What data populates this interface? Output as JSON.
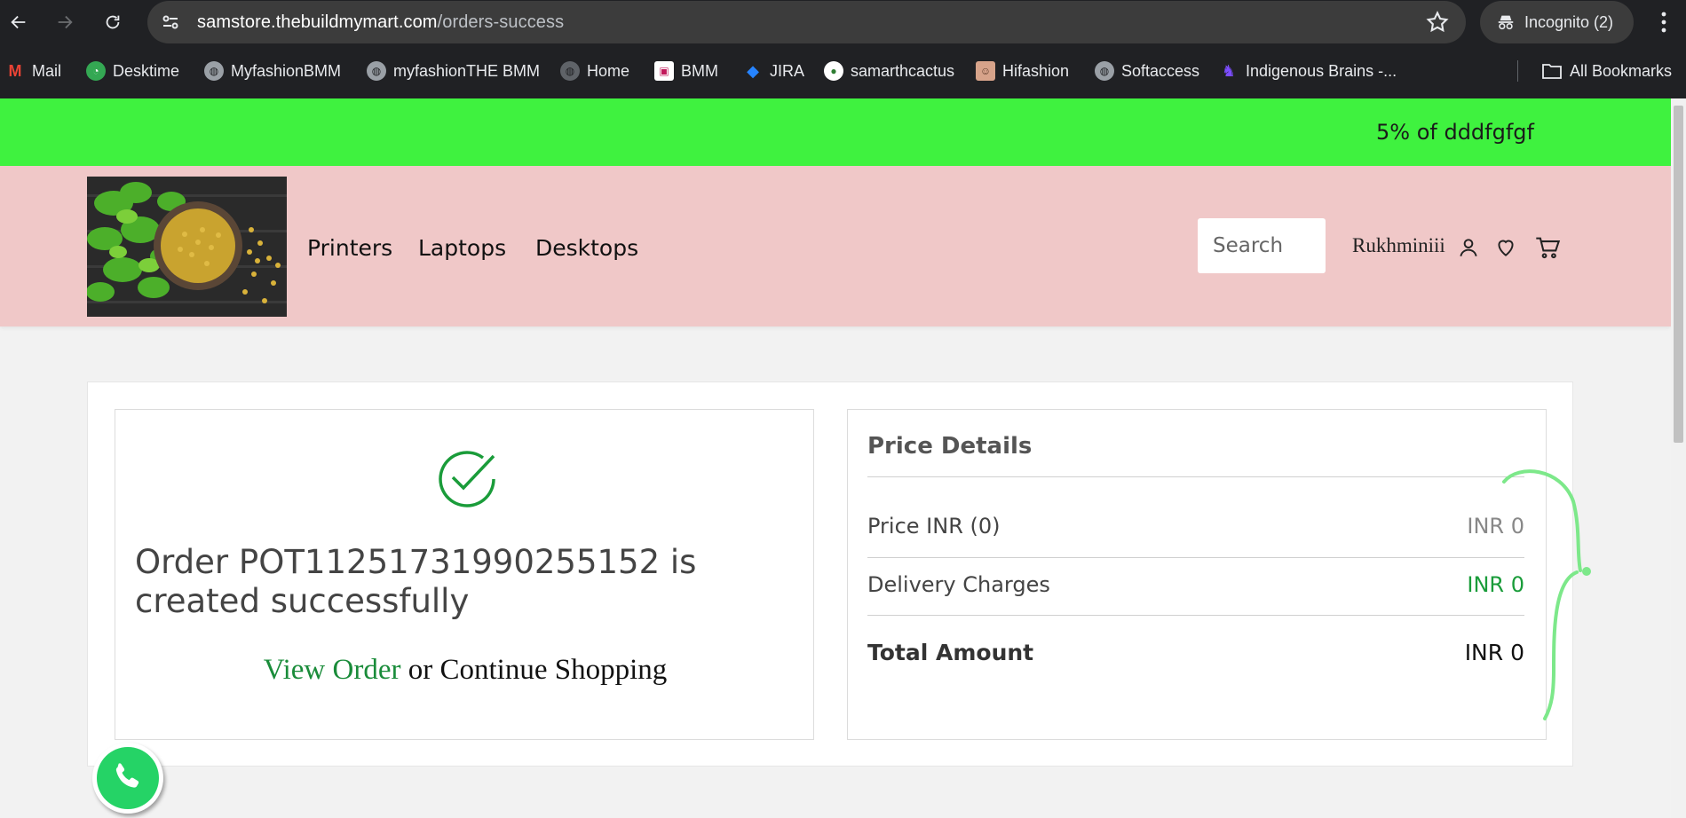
{
  "browser": {
    "url_host": "samstore.thebuildmymart.com",
    "url_path": "/orders-success",
    "incognito_label": "Incognito (2)"
  },
  "bookmarks": [
    {
      "label": "Mail"
    },
    {
      "label": "Desktime"
    },
    {
      "label": "MyfashionBMM"
    },
    {
      "label": "myfashionTHE BMM"
    },
    {
      "label": "Home"
    },
    {
      "label": "BMM"
    },
    {
      "label": "JIRA"
    },
    {
      "label": "samarthcactus"
    },
    {
      "label": "Hifashion"
    },
    {
      "label": "Softaccess"
    },
    {
      "label": "Indigenous Brains -..."
    }
  ],
  "all_bookmarks": "All Bookmarks",
  "promo": {
    "text": "5% of dddfgfgf",
    "color": "#3ff23f"
  },
  "header": {
    "nav": [
      "Printers",
      "Laptops",
      "Desktops"
    ],
    "search_placeholder": "Search",
    "username": "Rukhminiii",
    "color": "#f0c8c8"
  },
  "order": {
    "message": "Order POT11251731990255152 is created successfully",
    "view_order": "View Order",
    "or_text": " or ",
    "continue_shopping": "Continue Shopping"
  },
  "price_details": {
    "title": "Price Details",
    "rows": [
      {
        "label": "Price INR (0)",
        "value": "INR 0"
      },
      {
        "label": "Delivery Charges",
        "value": "INR 0"
      },
      {
        "label": "Total Amount",
        "value": "INR 0"
      }
    ]
  }
}
